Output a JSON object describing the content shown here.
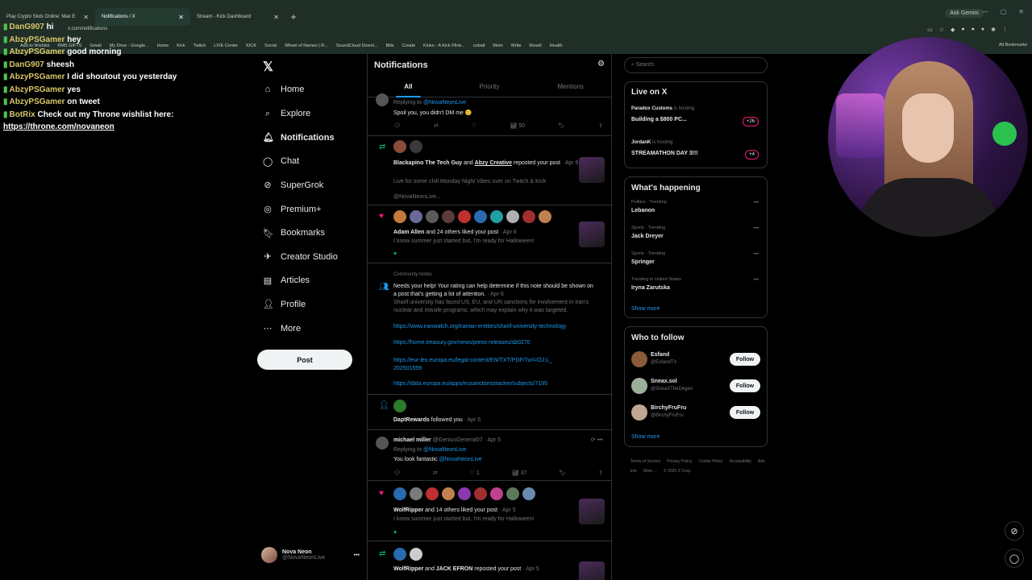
{
  "browser": {
    "tabs": [
      {
        "label": "Play Crypto Slots Online: Max E"
      },
      {
        "label": "Notifications / X"
      },
      {
        "label": "Stream - Kick Dashboard"
      }
    ],
    "ask_gemini": "Ask Gemini",
    "url": "x.com/notifications",
    "bookmarks": [
      "Add to Wishlist",
      "RMS GIFTS",
      "Gmail",
      "My Drive - Google...",
      "Home",
      "Kick",
      "Twitch",
      "LIVE Center",
      "KICK",
      "Social",
      "Wheel of Names | R...",
      "SoundCloud Downl...",
      "Bills",
      "Create",
      "Kinko - A Kick Plink...",
      "cobalt",
      "Mom",
      "Write",
      "Resell",
      "Health"
    ],
    "all_bookmarks": "All Bookmarks"
  },
  "chat": [
    {
      "user": "DanG907",
      "msg": "hi"
    },
    {
      "user": "AbzyPSGamer",
      "msg": "hey"
    },
    {
      "user": "AbzyPSGamer",
      "msg": "good morning"
    },
    {
      "user": "DanG907",
      "msg": "sheesh"
    },
    {
      "user": "AbzyPSGamer",
      "msg": "I did shoutout you yesterday"
    },
    {
      "user": "AbzyPSGamer",
      "msg": "yes"
    },
    {
      "user": "AbzyPSGamer",
      "msg": "on tweet"
    },
    {
      "user": "BotRix",
      "msg": "Check out my Throne wishlist here:"
    },
    {
      "user": "",
      "msg": "https://throne.com/novaneon"
    }
  ],
  "nav": {
    "items": [
      "Home",
      "Explore",
      "Notifications",
      "Chat",
      "SuperGrok",
      "Premium+",
      "Bookmarks",
      "Creator Studio",
      "Articles",
      "Profile",
      "More"
    ],
    "post": "Post",
    "profile_name": "Nova Neon",
    "profile_handle": "@NovaNeonLive"
  },
  "main": {
    "title": "Notifications",
    "tabs": [
      "All",
      "Priority",
      "Mentions"
    ],
    "n1": {
      "replying": "Replying to",
      "replying_handle": "@NovaNeonLive",
      "text": "Spoil you, you didn't DM me 😊",
      "views": "50"
    },
    "n2": {
      "user1": "Blackapino The Tech Guy",
      "and": "and",
      "user2": "Abzy Creative",
      "action": "reposted your post",
      "time": "· Apr 6",
      "text": "Live for some chill Monday Night Vibes over on Twitch & Kick",
      "handle": "@NovaNeonLive..."
    },
    "n3": {
      "user": "Adam Allen",
      "action": "and 24 others liked your post",
      "time": "· Apr 6",
      "text": "I know summer just started but, I'm ready for Halloween!"
    },
    "n4": {
      "label": "Community Notes",
      "text": "Needs your help! Your rating can help determine if this note should be shown on a post that's getting a lot of attention.",
      "time": "· Apr 6",
      "detail": "Sharif university has faced US, EU, and UN sanctions for involvement in Iran's nuclear and missile programs, which may explain why it was targeted.",
      "links": [
        "https://www.iranwatch.org/iranian-entities/sharif-university-technology",
        "https://home.treasury.gov/news/press-releases/sb0270",
        "https://eur-lex.europa.eu/legal-content/EN/TXT/PDF/?uri=OJ:L_202501559",
        "https://data.europa.eu/apps/eusanctionstracker/subjects/7195"
      ]
    },
    "n5": {
      "user": "DaptRewards",
      "action": "followed you",
      "time": "· Apr 6"
    },
    "n6": {
      "user": "michael miller",
      "handle": "@GeniusGeneral07 · Apr 5",
      "replying": "Replying to",
      "replying_handle": "@NovaNeonLive",
      "text": "You look fantastic",
      "mention": "@NovaNeonLive",
      "likes": "1",
      "views": "37"
    },
    "n7": {
      "user": "WolfRipper",
      "action": "and 14 others liked your post",
      "time": "· Apr 5",
      "text": "I know summer just started but, I'm ready for Halloween!"
    },
    "n8": {
      "user1": "WolfRipper",
      "and": "and",
      "user2": "JACK EFRON",
      "action": "reposted your post",
      "time": "· Apr 5"
    }
  },
  "right": {
    "search_placeholder": "Search",
    "live_title": "Live on X",
    "live": [
      {
        "user": "Paradox Customs",
        "status": "is hosting",
        "title": "Building a $800 PC...",
        "count": "+26"
      },
      {
        "user": "JordanK",
        "status": "is hosting",
        "title": "STREAMATHON DAY 3!!!",
        "count": "+4"
      }
    ],
    "happening_title": "What's happening",
    "trends": [
      {
        "cat": "Politics · Trending",
        "name": "Lebanon"
      },
      {
        "cat": "Sports · Trending",
        "name": "Jack Dreyer"
      },
      {
        "cat": "Sports · Trending",
        "name": "Springer"
      },
      {
        "cat": "Trending in United States",
        "name": "Iryna Zarutska"
      }
    ],
    "show_more": "Show more",
    "follow_title": "Who to follow",
    "follow": [
      {
        "name": "Esfand",
        "handle": "@EsfandTV"
      },
      {
        "name": "Sneax.sol",
        "handle": "@SneaXTheDegen"
      },
      {
        "name": "BirchyFruFru",
        "handle": "@BirchyFruFru"
      }
    ],
    "follow_label": "Follow",
    "footer": [
      "Terms of Service",
      "Privacy Policy",
      "Cookie Policy",
      "Accessibility",
      "Ads info",
      "More ...",
      "© 2025 X Corp."
    ]
  }
}
